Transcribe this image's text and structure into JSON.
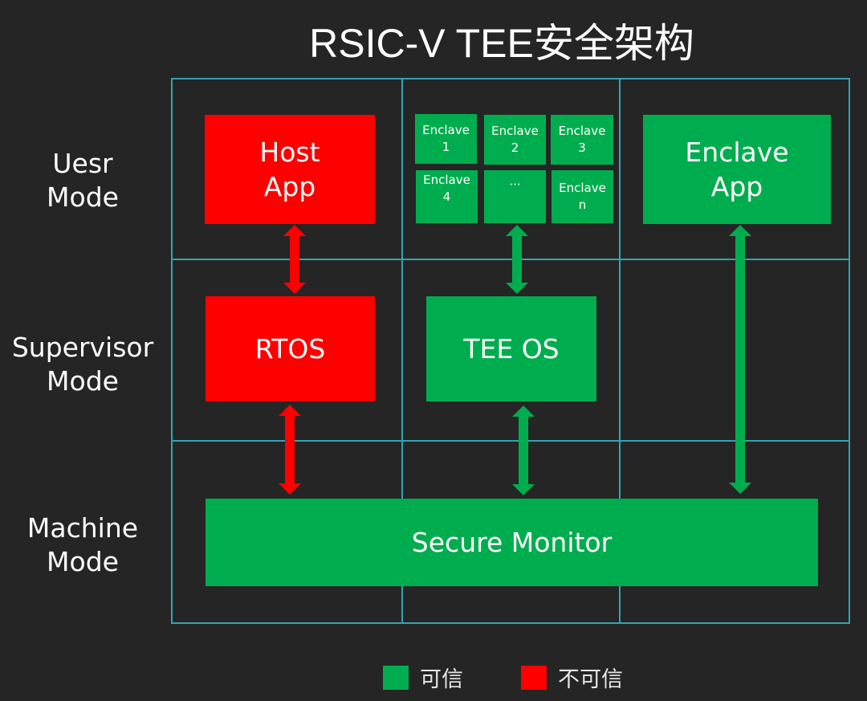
{
  "title": "RSIC-V TEE安全架构",
  "colors": {
    "trusted": "#00ad4e",
    "untrusted": "#ff0000",
    "grid": "#33a3b3",
    "background": "#252525"
  },
  "modes": [
    {
      "line1": "Uesr",
      "line2": "Mode"
    },
    {
      "line1": "Supervisor",
      "line2": "Mode"
    },
    {
      "line1": "Machine",
      "line2": "Mode"
    }
  ],
  "boxes": {
    "host_app": {
      "line1": "Host",
      "line2": "App",
      "trust": "untrusted"
    },
    "rtos": {
      "label": "RTOS",
      "trust": "untrusted"
    },
    "tee_os": {
      "label": "TEE OS",
      "trust": "trusted"
    },
    "enclave_app": {
      "line1": "Enclave",
      "line2": "App",
      "trust": "trusted"
    },
    "secure_monitor": {
      "label": "Secure Monitor",
      "trust": "trusted"
    }
  },
  "enclaves": [
    {
      "line1": "Enclave",
      "line2": "1"
    },
    {
      "line1": "Enclave",
      "line2": "2"
    },
    {
      "line1": "Enclave",
      "line2": "3"
    },
    {
      "line1": "Enclave",
      "line2": "4"
    },
    {
      "line1": "···",
      "line2": ""
    },
    {
      "line1": "Enclave",
      "line2": "n"
    }
  ],
  "arrows": [
    {
      "from": "Host App",
      "to": "RTOS",
      "trust": "untrusted"
    },
    {
      "from": "RTOS",
      "to": "Secure Monitor",
      "trust": "untrusted"
    },
    {
      "from": "Enclaves",
      "to": "TEE OS",
      "trust": "trusted"
    },
    {
      "from": "TEE OS",
      "to": "Secure Monitor",
      "trust": "trusted"
    },
    {
      "from": "Enclave App",
      "to": "Secure Monitor",
      "trust": "trusted"
    }
  ],
  "legend": {
    "trusted_label": "可信",
    "untrusted_label": "不可信"
  }
}
